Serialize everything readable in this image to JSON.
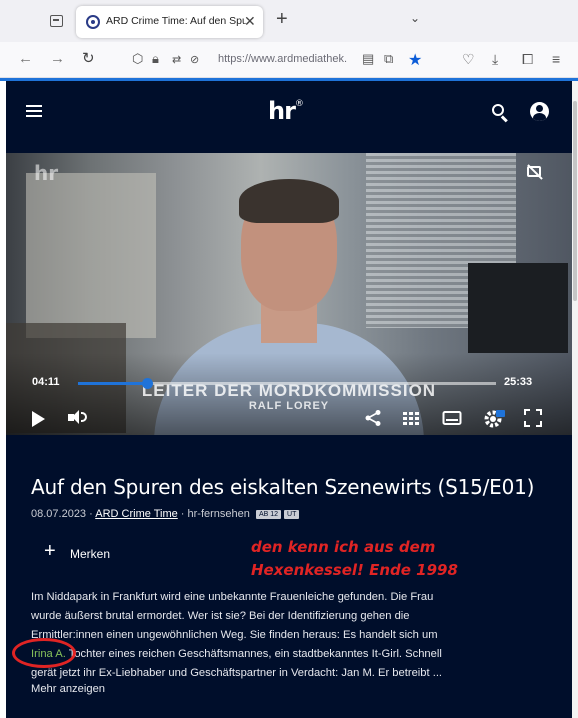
{
  "browser": {
    "tab_title": "ARD Crime Time: Auf den Spur",
    "tab_close": "✕",
    "new_tab": "+",
    "tab_list": "⌄",
    "url": "https://www.ardmediathek.",
    "nav_back": "←",
    "nav_forward": "→",
    "nav_reload": "↻"
  },
  "site": {
    "logo": "hr",
    "logo_mark": "®"
  },
  "player": {
    "time_current": "04:11",
    "time_total": "25:33",
    "progress_fraction": 0.164,
    "lower_third_title": "LEITER DER MORDKOMMISSION",
    "lower_third_name": "RALF LOREY"
  },
  "episode": {
    "title": "Auf den Spuren des eiskalten Szenewirts (S15/E01)",
    "date": "08.07.2023",
    "separator": " · ",
    "show_link": "ARD Crime Time",
    "channel": "hr-fernsehen",
    "badge_age": "AB 12",
    "badge_ut": "UT",
    "merken_label": "Merken",
    "description_lines": [
      "Im Niddapark in Frankfurt wird eine unbekannte Frauenleiche gefunden. Die Frau",
      "wurde äußerst brutal ermordet. Wer ist sie? Bei der Identifizierung gehen die",
      "Ermittler:innen einen ungewöhnlichen Weg. Sie finden heraus: Es handelt sich um"
    ],
    "description_name": "Irina A.",
    "description_line4_rest": " Tochter eines reichen Geschäftsmannes, ein stadtbekanntes It-Girl. Schnell",
    "description_line5": "gerät jetzt ihr Ex-Liebhaber und Geschäftspartner in Verdacht: Jan M. Er betreibt ...",
    "more_link": "Mehr anzeigen"
  },
  "annotation": {
    "line1": "den kenn ich aus dem",
    "line2": "Hexenkessel! Ende 1998"
  }
}
